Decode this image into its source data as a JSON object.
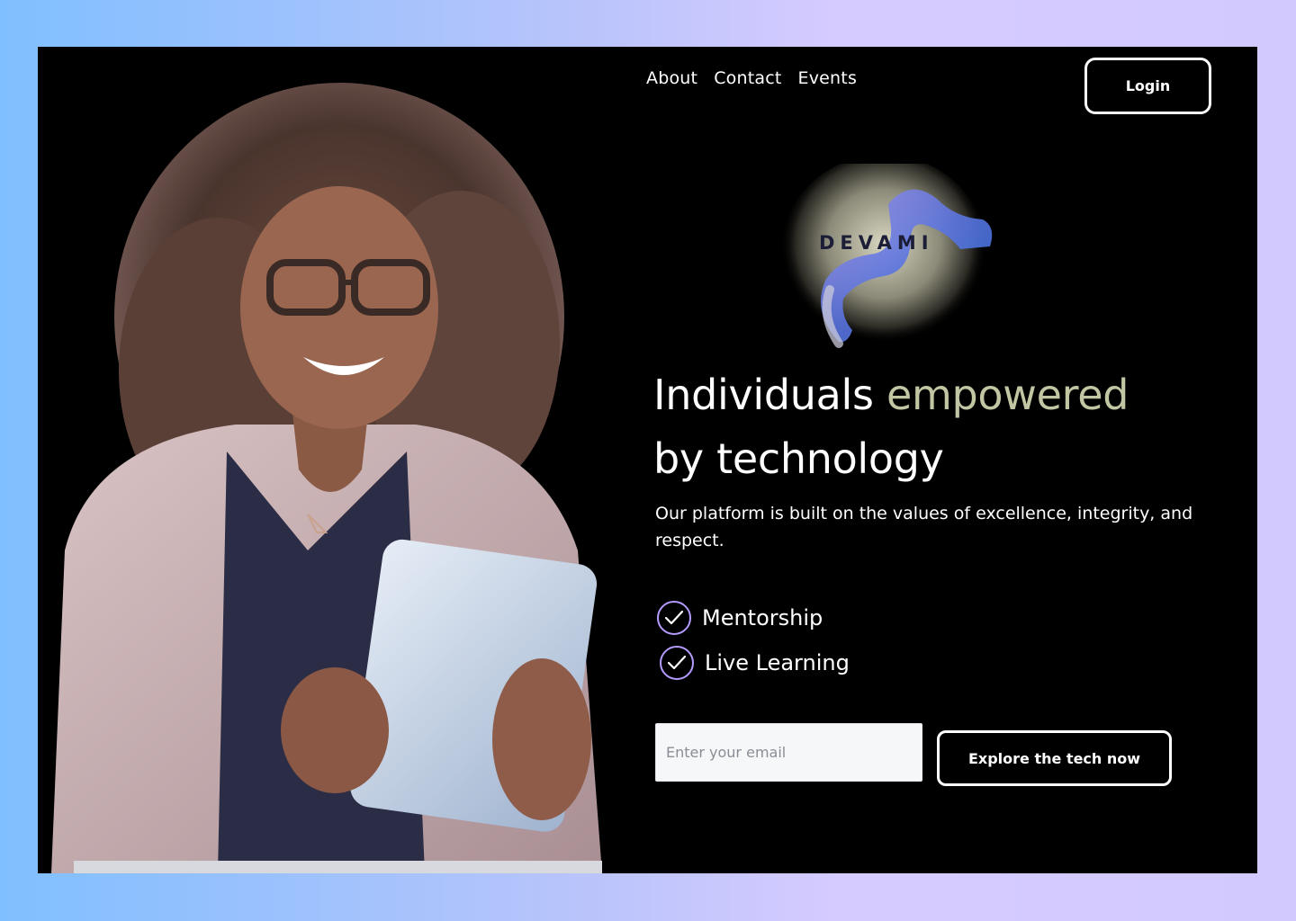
{
  "nav": {
    "links": [
      "About",
      "Contact",
      "Events"
    ],
    "login_label": "Login"
  },
  "brand": {
    "name": "DEVAMI"
  },
  "hero": {
    "headline_part1": "Individuals ",
    "headline_accent": "empowered",
    "headline_line2": "by technology",
    "subtext": "Our platform is built on the values of excellence, integrity, and respect.",
    "features": [
      {
        "label": "Mentorship",
        "icon": "check-circle-icon"
      },
      {
        "label": "Live Learning",
        "icon": "check-circle-icon"
      }
    ]
  },
  "form": {
    "email_placeholder": "Enter your email",
    "cta_label": "Explore the tech now"
  },
  "colors": {
    "background": "#000000",
    "accent_text": "#c3c6a3",
    "check_ring": "#b59bff",
    "page_gradient_start": "#80bfff",
    "page_gradient_end": "#d2caff"
  }
}
